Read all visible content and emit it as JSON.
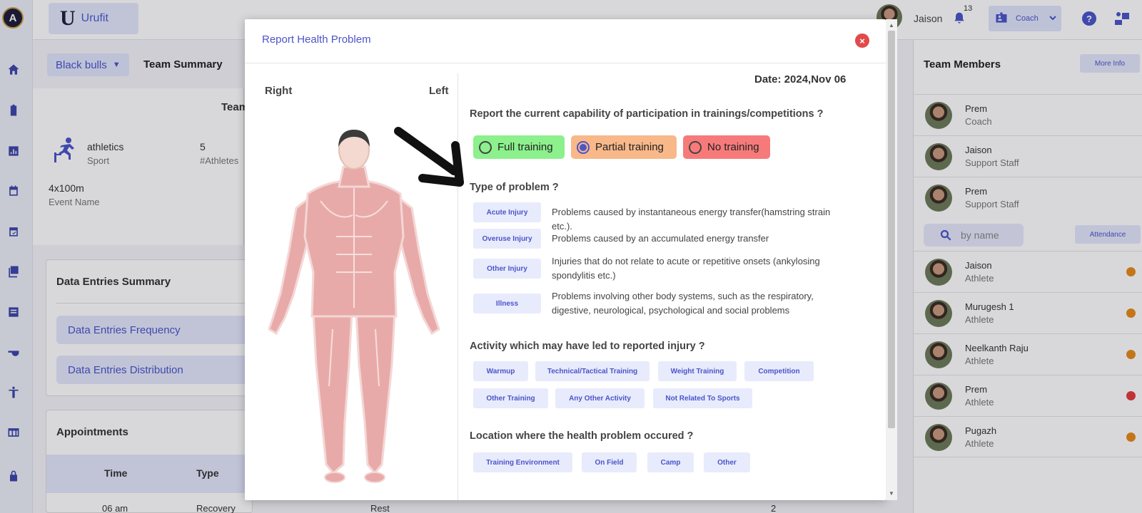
{
  "app": {
    "logo_text": "A",
    "brand_text": "Urufit",
    "brand_mark": "U",
    "user_name": "Jaison",
    "notification_count": "13",
    "role_label": "Coach",
    "help_glyph": "?"
  },
  "rail_icons": [
    "home-icon",
    "clipboard-icon",
    "bar-chart-icon",
    "calendar-icon",
    "calendar-check-icon",
    "stack-icon",
    "list-icon",
    "whistle-icon",
    "accessibility-icon",
    "table-icon",
    "lock-icon"
  ],
  "background": {
    "team_select": "Black bulls",
    "page_heading": "Team Summary",
    "team_header": "Team",
    "sport_value": "athletics",
    "sport_label": "Sport",
    "athletes_value": "5",
    "athletes_label": "#Athletes",
    "event_value": "4x100m",
    "event_label": "Event Name",
    "data_entries": {
      "title": "Data Entries Summary",
      "items": [
        "Data Entries Frequency",
        "Data Entries Distribution"
      ]
    },
    "appointments": {
      "title": "Appointments",
      "headers": [
        "Time",
        "Type"
      ],
      "row": {
        "time": "06 am",
        "type": "Recovery",
        "extra": "Rest",
        "count": "2"
      }
    }
  },
  "team_members": {
    "title": "Team Members",
    "more_info": "More Info",
    "staff": [
      {
        "name": "Prem",
        "role": "Coach"
      },
      {
        "name": "Jaison",
        "role": "Support Staff"
      },
      {
        "name": "Prem",
        "role": "Support Staff"
      }
    ],
    "search_placeholder": "by name",
    "attendance_button": "Attendance",
    "athletes": [
      {
        "name": "Jaison",
        "role": "Athlete",
        "status_color": "#e8891a"
      },
      {
        "name": "Murugesh 1",
        "role": "Athlete",
        "status_color": "#e8891a"
      },
      {
        "name": "Neelkanth Raju",
        "role": "Athlete",
        "status_color": "#e8891a"
      },
      {
        "name": "Prem",
        "role": "Athlete",
        "status_color": "#e23b3b"
      },
      {
        "name": "Pugazh",
        "role": "Athlete",
        "status_color": "#e8891a"
      }
    ]
  },
  "modal": {
    "title": "Report Health Problem",
    "close_glyph": "×",
    "body_right": "Right",
    "body_left": "Left",
    "date_text": "Date: 2024,Nov 06",
    "q_capability": "Report the current capability of participation in trainings/competitions ?",
    "capability_options": [
      {
        "label": "Full training",
        "color": "#8cf08c",
        "selected": false
      },
      {
        "label": "Partial training",
        "color": "#f8b889",
        "selected": true
      },
      {
        "label": "No training",
        "color": "#f77a7a",
        "selected": false
      }
    ],
    "q_problem_type": "Type of problem ?",
    "problem_types": [
      {
        "tag": "Acute Injury",
        "desc": "Problems caused by instantaneous energy transfer(hamstring strain etc.)."
      },
      {
        "tag": "Overuse Injury",
        "desc": "Problems caused by an accumulated energy transfer"
      },
      {
        "tag": "Other Injury",
        "desc": "Injuries that do not relate to acute or repetitive onsets (ankylosing spondylitis etc.)"
      },
      {
        "tag": "Illness",
        "desc": "Problems involving other body systems, such as the respiratory, digestive, neurological, psychological and social problems"
      }
    ],
    "q_activity": "Activity which may have led to reported injury ?",
    "activities": [
      "Warmup",
      "Technical/Tactical Training",
      "Weight Training",
      "Competition",
      "Other Training",
      "Any Other Activity",
      "Not Related To Sports"
    ],
    "q_location": "Location where the health problem occured ?",
    "locations": [
      "Training Environment",
      "On Field",
      "Camp",
      "Other"
    ]
  }
}
